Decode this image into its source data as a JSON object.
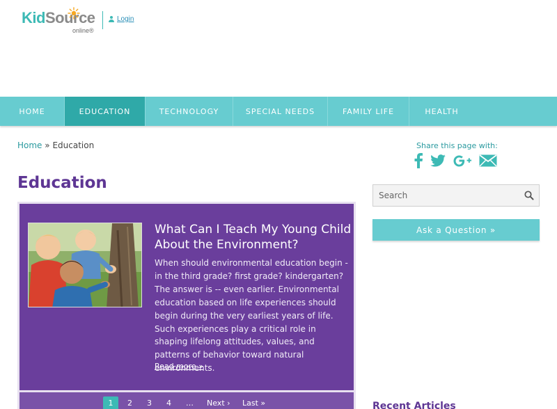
{
  "brand": {
    "name_k": "Kid",
    "name_rest": "Source",
    "tagline": "online",
    "trademark": "®"
  },
  "header": {
    "login_label": "Login"
  },
  "nav": {
    "items": [
      {
        "label": "HOME",
        "active": false
      },
      {
        "label": "EDUCATION",
        "active": true
      },
      {
        "label": "TECHNOLOGY",
        "active": false
      },
      {
        "label": "SPECIAL NEEDS",
        "active": false
      },
      {
        "label": "FAMILY LIFE",
        "active": false
      },
      {
        "label": "HEALTH",
        "active": false
      }
    ]
  },
  "breadcrumb": {
    "home": "Home",
    "separator": "»",
    "current": "Education"
  },
  "page": {
    "title": "Education"
  },
  "feature": {
    "title": "What Can I Teach My Young Child About the Environment?",
    "body": "When should environmental education begin - in the third grade? first grade? kindergarten? The answer is -- even earlier. Environmental education based on life experiences should begin during the very earliest years of life. Such experiences play a critical role in shaping lifelong attitudes, values, and patterns of behavior toward natural environments.",
    "read_more": "Read more »",
    "image_icon": "children-tree-photo"
  },
  "pager": {
    "pages": [
      "1",
      "2",
      "3",
      "4"
    ],
    "ellipsis": "…",
    "next": "Next ›",
    "last": "Last »",
    "current": "1"
  },
  "sidebar": {
    "share_label": "Share this page with:",
    "share_icons": [
      "facebook-icon",
      "twitter-icon",
      "google-plus-icon",
      "email-icon"
    ],
    "search_placeholder": "Search",
    "ask_label": "Ask a Question »",
    "recent_title": "Recent Articles"
  },
  "colors": {
    "teal": "#67ccd0",
    "teal_dark": "#2fa9a8",
    "purple": "#6a3e9c",
    "title_purple": "#5e3694"
  }
}
